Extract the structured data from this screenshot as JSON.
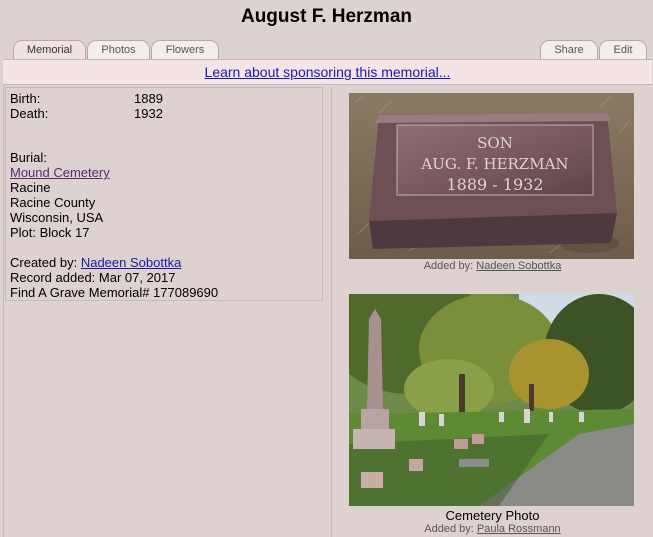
{
  "page_title": "August F. Herzman",
  "tabs": {
    "memorial": "Memorial",
    "photos": "Photos",
    "flowers": "Flowers",
    "share": "Share",
    "edit": "Edit"
  },
  "sponsor_link": "Learn about sponsoring this memorial...",
  "info": {
    "birth_label": "Birth:",
    "birth_value": "1889",
    "death_label": "Death:",
    "death_value": "1932",
    "burial_label": "Burial:",
    "cemetery": "Mound Cemetery",
    "city": "Racine",
    "county": "Racine County",
    "state_country": "Wisconsin, USA",
    "plot": "Plot: Block 17",
    "created_by_label": "Created by:",
    "created_by": "Nadeen Sobottka",
    "record_added": "Record added: Mar 07, 2017",
    "memorial_id": "Find A Grave Memorial# 177089690"
  },
  "photos": {
    "gravestone": {
      "inscription_line1": "SON",
      "inscription_line2": "AUG. F. HERZMAN",
      "inscription_line3": "1889 - 1932",
      "added_by_label": "Added by:",
      "added_by": "Nadeen Sobottka"
    },
    "cemetery": {
      "title": "Cemetery Photo",
      "added_by_label": "Added by:",
      "added_by": "Paula Rossmann"
    }
  }
}
